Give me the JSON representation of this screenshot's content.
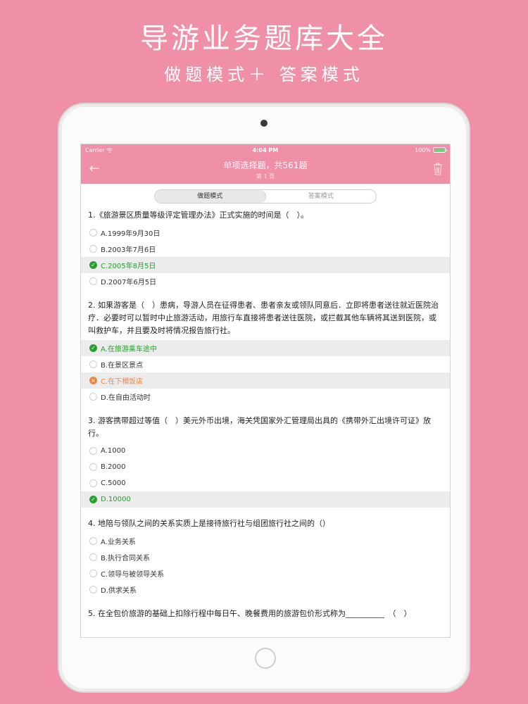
{
  "promo": {
    "title": "导游业务题库大全",
    "subtitle": "做题模式＋ 答案模式"
  },
  "status_bar": {
    "carrier": "Carrier",
    "time": "4:04 PM",
    "battery": "100%"
  },
  "nav": {
    "title": "单项选择题，共561题",
    "subtitle": "第 1 页"
  },
  "segment": {
    "practice_label": "做题模式",
    "answer_label": "答案模式"
  },
  "questions": [
    {
      "text": "1.《旅游景区质量等级评定管理办法》正式实施的时间是（　）。",
      "options": [
        {
          "label": "A.1999年9月30日",
          "state": "none"
        },
        {
          "label": "B.2003年7月6日",
          "state": "none"
        },
        {
          "label": "C.2005年8月5日",
          "state": "correct"
        },
        {
          "label": "D.2007年6月5日",
          "state": "none"
        }
      ]
    },
    {
      "text": "2. 如果游客是（　）患病，导游人员在征得患者、患者亲友或领队同意后．立即将患者送往就近医院治疗．必要时可以暂时中止旅游活动，用旅行车直接将患者送往医院，或拦截其他车辆将其送到医院，或叫救护车，并且要及时将情况报告旅行社。",
      "options": [
        {
          "label": "A.在旅游乘车途中",
          "state": "correct"
        },
        {
          "label": "B.在景区景点",
          "state": "none"
        },
        {
          "label": "C.在下榻饭店",
          "state": "wrong"
        },
        {
          "label": "D.在自由活动时",
          "state": "none"
        }
      ]
    },
    {
      "text": "3. 游客携带超过等值（　）美元外币出境，海关凭国家外汇管理局出具的《携带外汇出境许可证》放行。",
      "options": [
        {
          "label": "A.1000",
          "state": "none"
        },
        {
          "label": "B.2000",
          "state": "none"
        },
        {
          "label": "C.5000",
          "state": "none"
        },
        {
          "label": "D.10000",
          "state": "correct"
        }
      ]
    },
    {
      "text": "4. 地陪与领队之间的关系实质上是接待旅行社与组团旅行社之间的（）",
      "options": [
        {
          "label": "A.业务关系",
          "state": "none"
        },
        {
          "label": "B.执行合同关系",
          "state": "none"
        },
        {
          "label": "C.领导与被领导关系",
          "state": "none"
        },
        {
          "label": "D.供求关系",
          "state": "none"
        }
      ]
    },
    {
      "text": "5. 在全包价旅游的基础上扣除行程中每日午、晚餐费用的旅游包价形式称为__________　（　）",
      "options": []
    }
  ],
  "colors": {
    "brand_pink": "#f08fa8",
    "correct": "#25a12e",
    "wrong": "#f3823c"
  },
  "icons": {
    "back": "arrow-left-icon",
    "trash": "trash-icon",
    "wifi": "wifi-icon",
    "battery": "battery-icon",
    "check": "check-icon",
    "cross": "cross-icon"
  }
}
